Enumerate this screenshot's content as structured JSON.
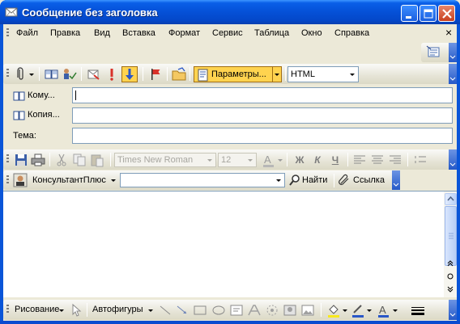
{
  "window": {
    "title": "Сообщение без заголовка"
  },
  "menu": {
    "items": [
      {
        "label": "Файл"
      },
      {
        "label": "Правка"
      },
      {
        "label": "Вид"
      },
      {
        "label": "Вставка"
      },
      {
        "label": "Формат"
      },
      {
        "label": "Сервис"
      },
      {
        "label": "Таблица"
      },
      {
        "label": "Окно"
      },
      {
        "label": "Справка"
      }
    ],
    "close_glyph": "×"
  },
  "standard_toolbar": {
    "options_label": "Параметры...",
    "format_value": "HTML"
  },
  "header_fields": {
    "to_label": "Кому...",
    "cc_label": "Копия...",
    "subject_label": "Тема:",
    "to_value": "",
    "cc_value": "",
    "subject_value": ""
  },
  "formatting_toolbar": {
    "font_value": "Times New Roman",
    "size_value": "12",
    "bold": "Ж",
    "italic": "К",
    "underline": "Ч"
  },
  "consultant_toolbar": {
    "name": "КонсультантПлюс",
    "search_value": "",
    "find_label": "Найти",
    "link_label": "Ссылка"
  },
  "drawing_toolbar": {
    "draw_label": "Рисование",
    "autoshapes_label": "Автофигуры"
  },
  "colors": {
    "title_blue": "#0552d9",
    "toolbar_face": "#ece9d8",
    "highlight": "#ffd34f"
  }
}
